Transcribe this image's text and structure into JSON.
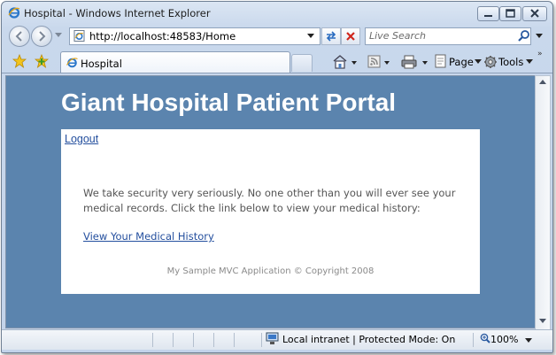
{
  "window": {
    "title": "Hospital - Windows Internet Explorer"
  },
  "toolbar": {
    "address": "http://localhost:48583/Home",
    "search_placeholder": "Live Search",
    "tab_label": "Hospital",
    "page_label": "Page",
    "tools_label": "Tools"
  },
  "page": {
    "site_title": "Giant Hospital Patient Portal",
    "logout_label": "Logout",
    "intro": "We take security very seriously. No one other than you will ever see your medical records. Click the link below to view your medical history:",
    "history_link": "View Your Medical History",
    "footer": "My Sample MVC Application © Copyright 2008"
  },
  "status": {
    "zone": "Local intranet | Protected Mode: On",
    "zoom": "100%"
  },
  "colors": {
    "page_background": "#5b84ae",
    "link": "#244f9e"
  }
}
